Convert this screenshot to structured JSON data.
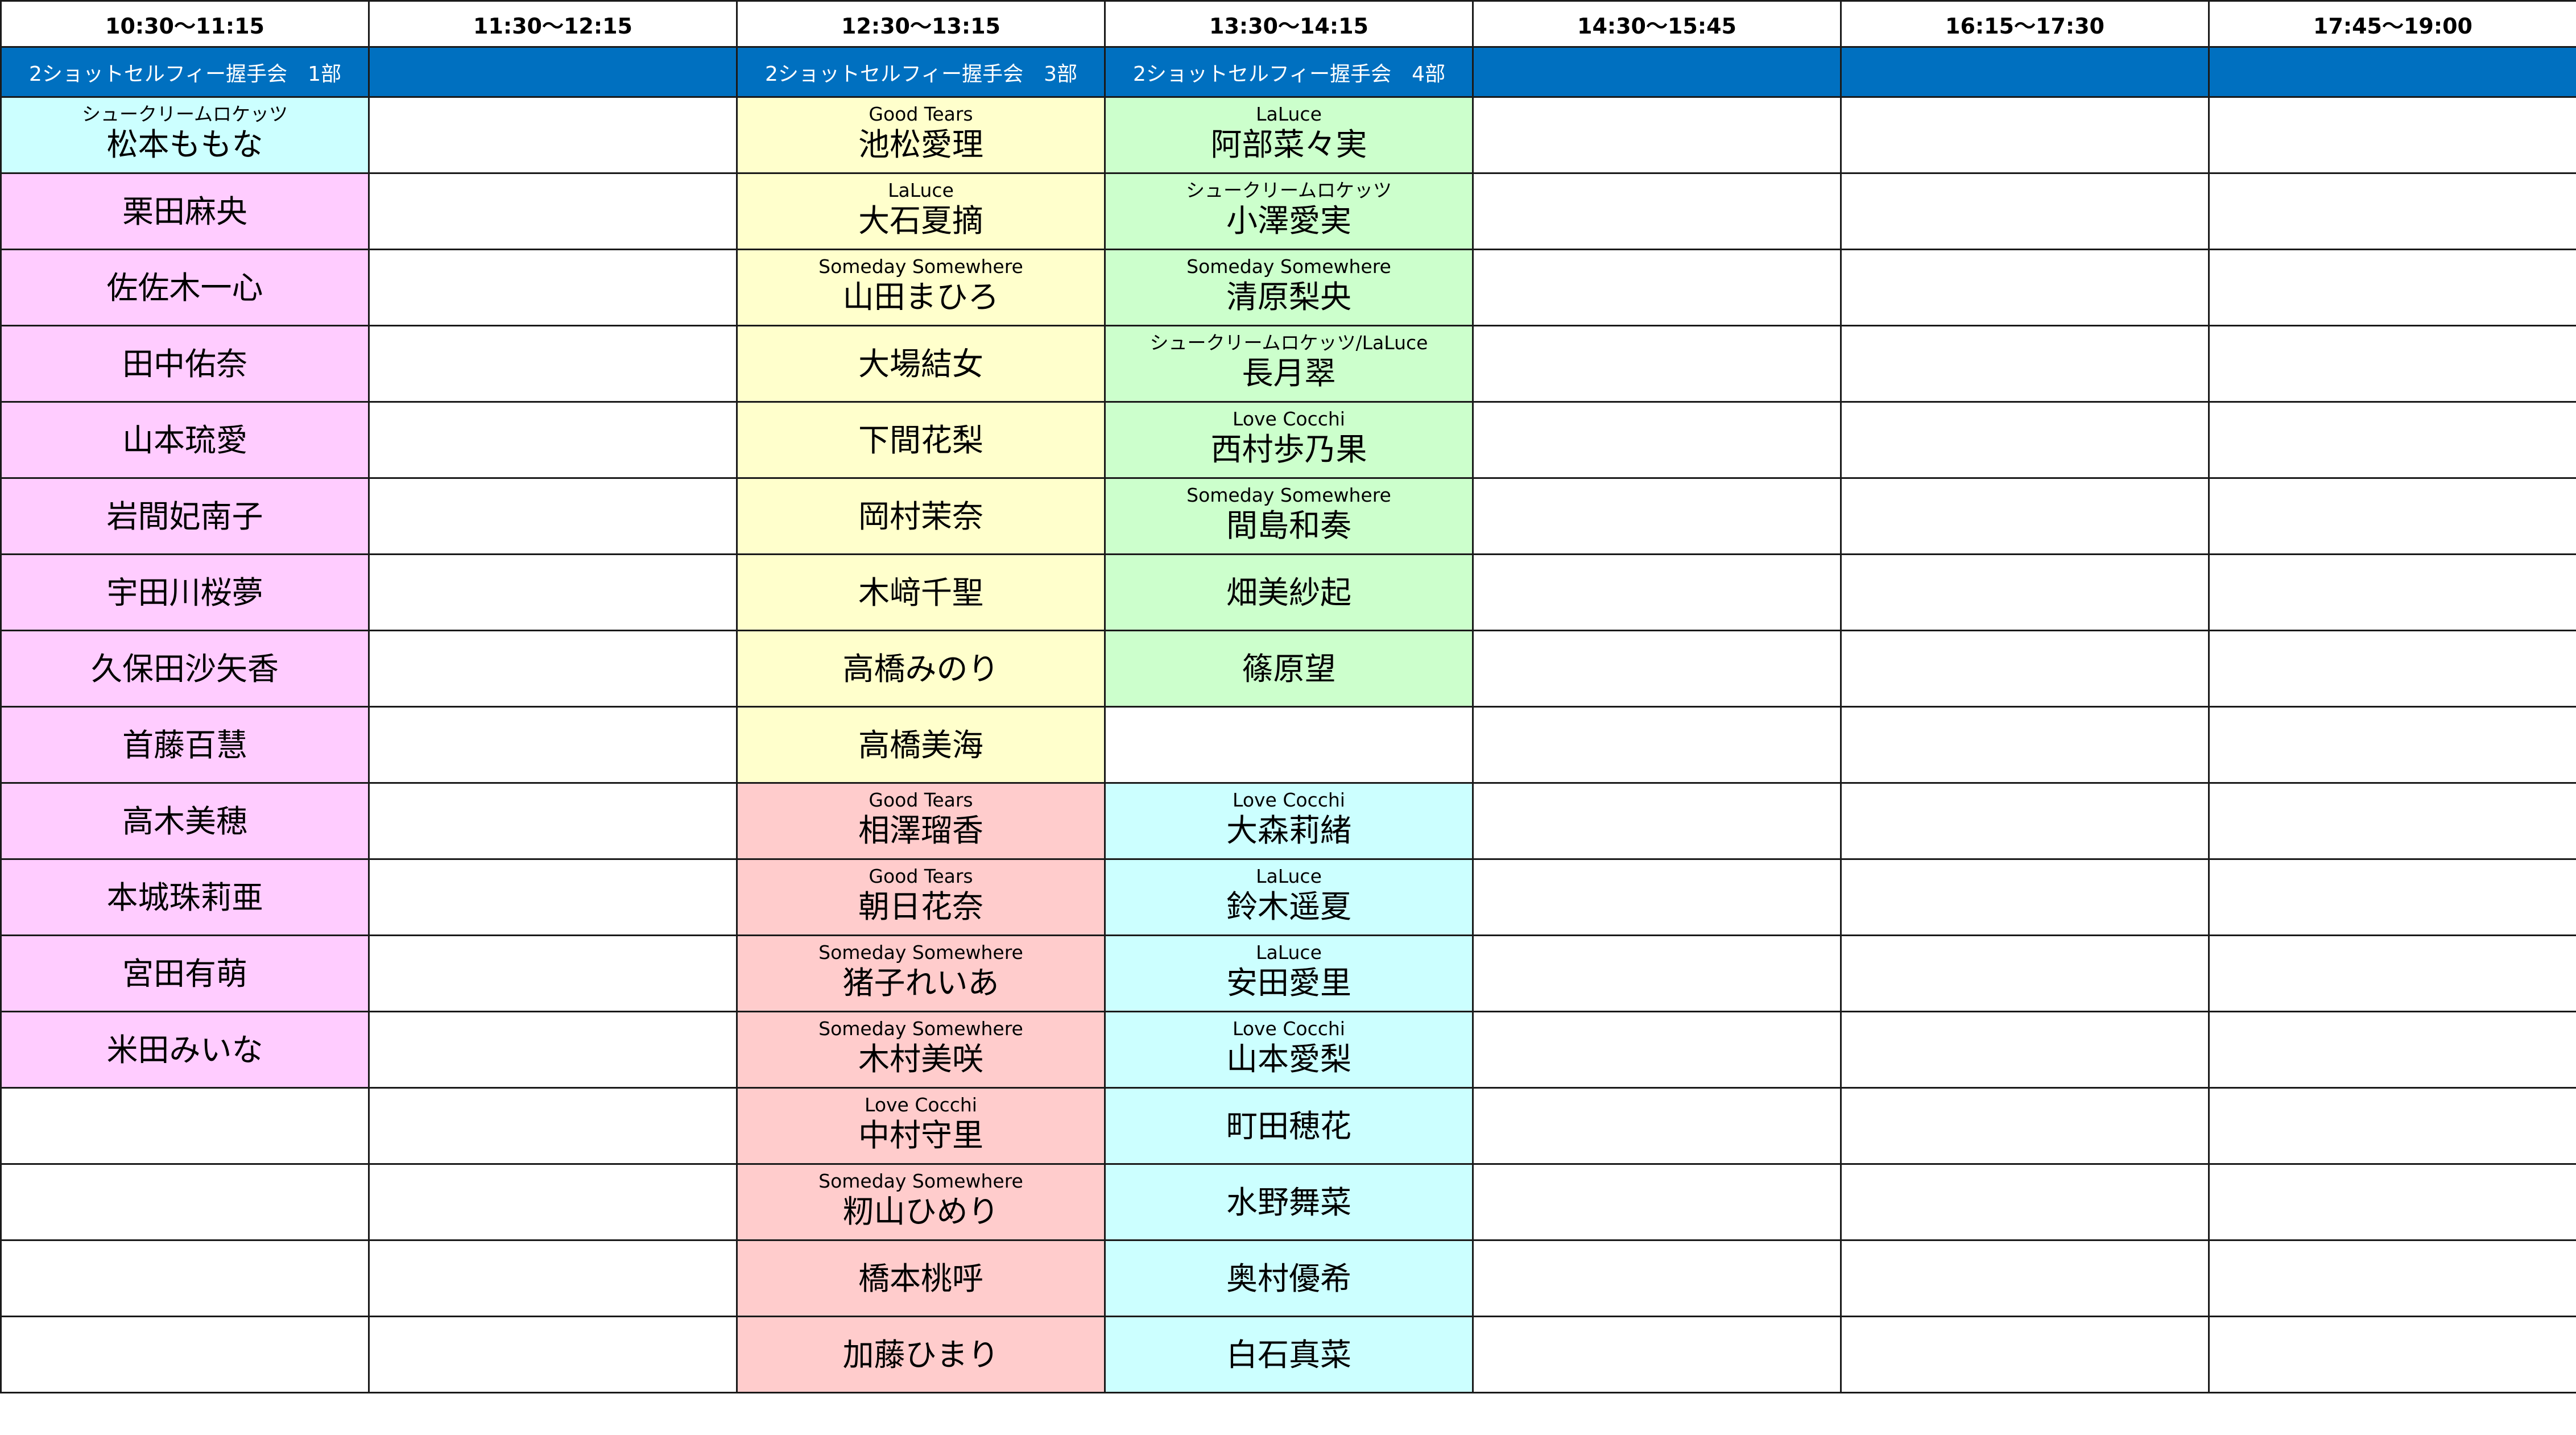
{
  "headers": [
    "10:30〜11:15",
    "11:30〜12:15",
    "12:30〜13:15",
    "13:30〜14:15",
    "14:30〜15:45",
    "16:15〜17:30",
    "17:45〜19:00"
  ],
  "band": [
    "2ショットセルフィー握手会　1部",
    "",
    "2ショットセルフィー握手会　3部",
    "2ショットセルフィー握手会　4部",
    "",
    "",
    ""
  ],
  "colors": {
    "band": "#0070c0",
    "cyan": "#ccffff",
    "pink": "#ffccff",
    "yellow": "#ffffcc",
    "green": "#ccffcc",
    "red": "#ffcccc",
    "white": "#ffffff"
  },
  "rows": [
    [
      {
        "group": "シュークリームロケッツ",
        "name": "松本ももな",
        "color": "cyan"
      },
      {
        "group": "",
        "name": "",
        "color": "white"
      },
      {
        "group": "Good Tears",
        "name": "池松愛理",
        "color": "yellow"
      },
      {
        "group": "LaLuce",
        "name": "阿部菜々実",
        "color": "green"
      },
      {
        "group": "",
        "name": "",
        "color": "white"
      },
      {
        "group": "",
        "name": "",
        "color": "white"
      },
      {
        "group": "",
        "name": "",
        "color": "white"
      }
    ],
    [
      {
        "group": "",
        "name": "栗田麻央",
        "color": "pink"
      },
      {
        "group": "",
        "name": "",
        "color": "white"
      },
      {
        "group": "LaLuce",
        "name": "大石夏摘",
        "color": "yellow"
      },
      {
        "group": "シュークリームロケッツ",
        "name": "小澤愛実",
        "color": "green"
      },
      {
        "group": "",
        "name": "",
        "color": "white"
      },
      {
        "group": "",
        "name": "",
        "color": "white"
      },
      {
        "group": "",
        "name": "",
        "color": "white"
      }
    ],
    [
      {
        "group": "",
        "name": "佐佐木一心",
        "color": "pink"
      },
      {
        "group": "",
        "name": "",
        "color": "white"
      },
      {
        "group": "Someday Somewhere",
        "name": "山田まひろ",
        "color": "yellow"
      },
      {
        "group": "Someday Somewhere",
        "name": "清原梨央",
        "color": "green"
      },
      {
        "group": "",
        "name": "",
        "color": "white"
      },
      {
        "group": "",
        "name": "",
        "color": "white"
      },
      {
        "group": "",
        "name": "",
        "color": "white"
      }
    ],
    [
      {
        "group": "",
        "name": "田中佑奈",
        "color": "pink"
      },
      {
        "group": "",
        "name": "",
        "color": "white"
      },
      {
        "group": "",
        "name": "大場結女",
        "color": "yellow"
      },
      {
        "group": "シュークリームロケッツ/LaLuce",
        "name": "長月翠",
        "color": "green"
      },
      {
        "group": "",
        "name": "",
        "color": "white"
      },
      {
        "group": "",
        "name": "",
        "color": "white"
      },
      {
        "group": "",
        "name": "",
        "color": "white"
      }
    ],
    [
      {
        "group": "",
        "name": "山本琉愛",
        "color": "pink"
      },
      {
        "group": "",
        "name": "",
        "color": "white"
      },
      {
        "group": "",
        "name": "下間花梨",
        "color": "yellow"
      },
      {
        "group": "Love Cocchi",
        "name": "西村歩乃果",
        "color": "green"
      },
      {
        "group": "",
        "name": "",
        "color": "white"
      },
      {
        "group": "",
        "name": "",
        "color": "white"
      },
      {
        "group": "",
        "name": "",
        "color": "white"
      }
    ],
    [
      {
        "group": "",
        "name": "岩間妃南子",
        "color": "pink"
      },
      {
        "group": "",
        "name": "",
        "color": "white"
      },
      {
        "group": "",
        "name": "岡村茉奈",
        "color": "yellow"
      },
      {
        "group": "Someday Somewhere",
        "name": "間島和奏",
        "color": "green"
      },
      {
        "group": "",
        "name": "",
        "color": "white"
      },
      {
        "group": "",
        "name": "",
        "color": "white"
      },
      {
        "group": "",
        "name": "",
        "color": "white"
      }
    ],
    [
      {
        "group": "",
        "name": "宇田川桜夢",
        "color": "pink"
      },
      {
        "group": "",
        "name": "",
        "color": "white"
      },
      {
        "group": "",
        "name": "木﨑千聖",
        "color": "yellow"
      },
      {
        "group": "",
        "name": "畑美紗起",
        "color": "green"
      },
      {
        "group": "",
        "name": "",
        "color": "white"
      },
      {
        "group": "",
        "name": "",
        "color": "white"
      },
      {
        "group": "",
        "name": "",
        "color": "white"
      }
    ],
    [
      {
        "group": "",
        "name": "久保田沙矢香",
        "color": "pink"
      },
      {
        "group": "",
        "name": "",
        "color": "white"
      },
      {
        "group": "",
        "name": "高橋みのり",
        "color": "yellow"
      },
      {
        "group": "",
        "name": "篠原望",
        "color": "green"
      },
      {
        "group": "",
        "name": "",
        "color": "white"
      },
      {
        "group": "",
        "name": "",
        "color": "white"
      },
      {
        "group": "",
        "name": "",
        "color": "white"
      }
    ],
    [
      {
        "group": "",
        "name": "首藤百慧",
        "color": "pink"
      },
      {
        "group": "",
        "name": "",
        "color": "white"
      },
      {
        "group": "",
        "name": "高橋美海",
        "color": "yellow"
      },
      {
        "group": "",
        "name": "",
        "color": "white"
      },
      {
        "group": "",
        "name": "",
        "color": "white"
      },
      {
        "group": "",
        "name": "",
        "color": "white"
      },
      {
        "group": "",
        "name": "",
        "color": "white"
      }
    ],
    [
      {
        "group": "",
        "name": "高木美穂",
        "color": "pink"
      },
      {
        "group": "",
        "name": "",
        "color": "white"
      },
      {
        "group": "Good Tears",
        "name": "相澤瑠香",
        "color": "red"
      },
      {
        "group": "Love Cocchi",
        "name": "大森莉緒",
        "color": "cyan"
      },
      {
        "group": "",
        "name": "",
        "color": "white"
      },
      {
        "group": "",
        "name": "",
        "color": "white"
      },
      {
        "group": "",
        "name": "",
        "color": "white"
      }
    ],
    [
      {
        "group": "",
        "name": "本城珠莉亜",
        "color": "pink"
      },
      {
        "group": "",
        "name": "",
        "color": "white"
      },
      {
        "group": "Good Tears",
        "name": "朝日花奈",
        "color": "red"
      },
      {
        "group": "LaLuce",
        "name": "鈴木遥夏",
        "color": "cyan"
      },
      {
        "group": "",
        "name": "",
        "color": "white"
      },
      {
        "group": "",
        "name": "",
        "color": "white"
      },
      {
        "group": "",
        "name": "",
        "color": "white"
      }
    ],
    [
      {
        "group": "",
        "name": "宮田有萌",
        "color": "pink"
      },
      {
        "group": "",
        "name": "",
        "color": "white"
      },
      {
        "group": "Someday Somewhere",
        "name": "猪子れいあ",
        "color": "red"
      },
      {
        "group": "LaLuce",
        "name": "安田愛里",
        "color": "cyan"
      },
      {
        "group": "",
        "name": "",
        "color": "white"
      },
      {
        "group": "",
        "name": "",
        "color": "white"
      },
      {
        "group": "",
        "name": "",
        "color": "white"
      }
    ],
    [
      {
        "group": "",
        "name": "米田みいな",
        "color": "pink"
      },
      {
        "group": "",
        "name": "",
        "color": "white"
      },
      {
        "group": "Someday Somewhere",
        "name": "木村美咲",
        "color": "red"
      },
      {
        "group": "Love Cocchi",
        "name": "山本愛梨",
        "color": "cyan"
      },
      {
        "group": "",
        "name": "",
        "color": "white"
      },
      {
        "group": "",
        "name": "",
        "color": "white"
      },
      {
        "group": "",
        "name": "",
        "color": "white"
      }
    ],
    [
      {
        "group": "",
        "name": "",
        "color": "white"
      },
      {
        "group": "",
        "name": "",
        "color": "white"
      },
      {
        "group": "Love Cocchi",
        "name": "中村守里",
        "color": "red"
      },
      {
        "group": "",
        "name": "町田穂花",
        "color": "cyan"
      },
      {
        "group": "",
        "name": "",
        "color": "white"
      },
      {
        "group": "",
        "name": "",
        "color": "white"
      },
      {
        "group": "",
        "name": "",
        "color": "white"
      }
    ],
    [
      {
        "group": "",
        "name": "",
        "color": "white"
      },
      {
        "group": "",
        "name": "",
        "color": "white"
      },
      {
        "group": "Someday Somewhere",
        "name": "籾山ひめり",
        "color": "red"
      },
      {
        "group": "",
        "name": "水野舞菜",
        "color": "cyan"
      },
      {
        "group": "",
        "name": "",
        "color": "white"
      },
      {
        "group": "",
        "name": "",
        "color": "white"
      },
      {
        "group": "",
        "name": "",
        "color": "white"
      }
    ],
    [
      {
        "group": "",
        "name": "",
        "color": "white"
      },
      {
        "group": "",
        "name": "",
        "color": "white"
      },
      {
        "group": "",
        "name": "橋本桃呼",
        "color": "red"
      },
      {
        "group": "",
        "name": "奥村優希",
        "color": "cyan"
      },
      {
        "group": "",
        "name": "",
        "color": "white"
      },
      {
        "group": "",
        "name": "",
        "color": "white"
      },
      {
        "group": "",
        "name": "",
        "color": "white"
      }
    ],
    [
      {
        "group": "",
        "name": "",
        "color": "white"
      },
      {
        "group": "",
        "name": "",
        "color": "white"
      },
      {
        "group": "",
        "name": "加藤ひまり",
        "color": "red"
      },
      {
        "group": "",
        "name": "白石真菜",
        "color": "cyan"
      },
      {
        "group": "",
        "name": "",
        "color": "white"
      },
      {
        "group": "",
        "name": "",
        "color": "white"
      },
      {
        "group": "",
        "name": "",
        "color": "white"
      }
    ]
  ]
}
